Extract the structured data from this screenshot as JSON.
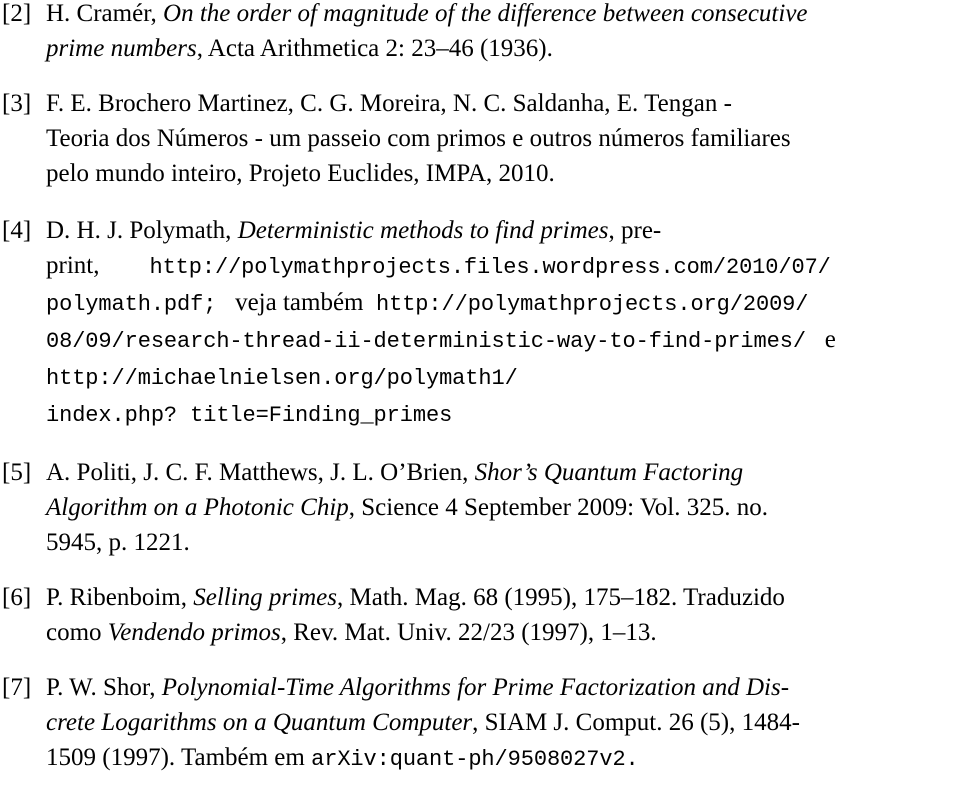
{
  "document": {
    "kind": "bibliography",
    "background_color": "#ffffff",
    "text_color": "#000000"
  },
  "references": [
    {
      "tag": "[2]",
      "number": "2",
      "authors": "H. Cramér,",
      "title": "On the order of magnitude of the difference between consecutive prime numbers",
      "source": "Acta Arithmetica 2: 23–46 (1936).",
      "lines": [
        {
          "parts": [
            {
              "text": "H. Cramér, ",
              "style": "roman"
            },
            {
              "text": "On the order of magnitude of the difference between consecutive",
              "style": "italic"
            }
          ]
        },
        {
          "parts": [
            {
              "text": "prime numbers",
              "style": "italic"
            },
            {
              "text": ", Acta Arithmetica 2: 23–46 (1936).",
              "style": "roman"
            }
          ]
        }
      ]
    },
    {
      "tag": "[3]",
      "number": "3",
      "authors": "F. E. Brochero Martinez, C. G. Moreira, N. C. Saldanha, E. Tengan",
      "title": "Teoria dos Números - um passeio com primos e outros números familiares pelo mundo inteiro",
      "source": "Projeto Euclides, IMPA, 2010.",
      "lines": [
        {
          "parts": [
            {
              "text": "F. E. Brochero Martinez, C. G. Moreira, N. C. Saldanha, E. Tengan -",
              "style": "roman"
            }
          ]
        },
        {
          "parts": [
            {
              "text": "Teoria dos Números - um passeio com primos e outros números familiares",
              "style": "roman"
            }
          ]
        },
        {
          "parts": [
            {
              "text": "pelo mundo inteiro, Projeto Euclides, IMPA, 2010.",
              "style": "roman"
            }
          ]
        }
      ]
    },
    {
      "tag": "[4]",
      "number": "4",
      "authors": "D. H. J. Polymath,",
      "title": "Deterministic methods to find primes",
      "source": "preprint",
      "urls": [
        "http://polymathprojects.files.wordpress.com/2010/07/polymath.pdf",
        "http://polymathprojects.org/2009/08/09/research-thread-ii-deterministic-way-to-find-primes/",
        "http://michaelnielsen.org/polymath1/index.php?title=Finding_primes"
      ],
      "lines": [
        {
          "parts": [
            {
              "text": "D. H. J. Polymath, ",
              "style": "roman"
            },
            {
              "text": "Deterministic methods to find primes",
              "style": "italic"
            },
            {
              "text": ", pre-",
              "style": "roman"
            }
          ]
        },
        {
          "parts": [
            {
              "text": "print,",
              "style": "roman"
            },
            {
              "text": "http://polymathprojects.files.wordpress.com/2010/07/",
              "style": "mono"
            }
          ]
        },
        {
          "parts": [
            {
              "text": "polymath.pdf;",
              "style": "mono"
            },
            {
              "text": "veja também",
              "style": "roman"
            },
            {
              "text": "http://polymathprojects.org/2009/",
              "style": "mono"
            }
          ]
        },
        {
          "parts": [
            {
              "text": "08/09/research-thread-ii-deterministic-way-to-find-primes/",
              "style": "mono"
            },
            {
              "text": "e",
              "style": "roman"
            }
          ]
        },
        {
          "parts": [
            {
              "text": "http://michaelnielsen.org/polymath1/",
              "style": "mono"
            }
          ]
        },
        {
          "parts": [
            {
              "text": "index.php? title=Finding_primes",
              "style": "mono"
            }
          ]
        }
      ],
      "line2_pre": "print,",
      "line2_url": "http://polymathprojects.files.wordpress.com/2010/07/",
      "line3_url_a": "polymath.pdf;",
      "line3_mid": "veja também",
      "line3_url_b": "http://polymathprojects.org/2009/",
      "line4_url": "08/09/research-thread-ii-deterministic-way-to-find-primes/",
      "line4_tail": "e",
      "line5_url": "http://michaelnielsen.org/polymath1/",
      "line6_url": "index.php? title=Finding_primes"
    },
    {
      "tag": "[5]",
      "number": "5",
      "authors": "A. Politi, J. C. F. Matthews, J. L. O’Brien,",
      "title": "Shor’s Quantum Factoring Algorithm on a Photonic Chip",
      "source": "Science 4 September 2009: Vol. 325. no. 5945, p. 1221.",
      "lines": [
        {
          "parts": [
            {
              "text": "A. Politi, J. C. F. Matthews, J. L. O’Brien, ",
              "style": "roman"
            },
            {
              "text": "Shor’s Quantum Factoring",
              "style": "italic"
            }
          ]
        },
        {
          "parts": [
            {
              "text": "Algorithm on a Photonic Chip",
              "style": "italic"
            },
            {
              "text": ", Science 4 September 2009: Vol. 325. no.",
              "style": "roman"
            }
          ]
        },
        {
          "parts": [
            {
              "text": "5945, p. 1221.",
              "style": "roman"
            }
          ]
        }
      ]
    },
    {
      "tag": "[6]",
      "number": "6",
      "authors": "P. Ribenboim,",
      "title": "Selling primes",
      "source": "Math. Mag. 68 (1995), 175–182. Traduzido como Vendendo primos, Rev. Mat. Univ. 22/23 (1997), 1–13.",
      "lines": [
        {
          "parts": [
            {
              "text": "P. Ribenboim, ",
              "style": "roman"
            },
            {
              "text": "Selling primes",
              "style": "italic"
            },
            {
              "text": ", Math. Mag. 68 (1995), 175–182. Traduzido",
              "style": "roman"
            }
          ]
        },
        {
          "parts": [
            {
              "text": "como ",
              "style": "roman"
            },
            {
              "text": "Vendendo primos",
              "style": "italic"
            },
            {
              "text": ", Rev. Mat. Univ. 22/23 (1997), 1–13.",
              "style": "roman"
            }
          ]
        }
      ]
    },
    {
      "tag": "[7]",
      "number": "7",
      "authors": "P. W. Shor,",
      "title": "Polynomial-Time Algorithms for Prime Factorization and Discrete Logarithms on a Quantum Computer",
      "source": "SIAM J. Comput. 26 (5), 1484-1509 (1997). Também em arXiv:quant-ph/9508027v2.",
      "arxiv": "arXiv:quant-ph/9508027v2.",
      "lines": [
        {
          "parts": [
            {
              "text": "P. W. Shor, ",
              "style": "roman"
            },
            {
              "text": "Polynomial-Time Algorithms for Prime Factorization and Dis-",
              "style": "italic"
            }
          ]
        },
        {
          "parts": [
            {
              "text": "crete Logarithms on a Quantum Computer",
              "style": "italic"
            },
            {
              "text": ", SIAM J. Comput. 26 (5), 1484-",
              "style": "roman"
            }
          ]
        },
        {
          "parts": [
            {
              "text": "1509 (1997). Também em ",
              "style": "roman"
            },
            {
              "text": "arXiv:quant-ph/9508027v2.",
              "style": "mono"
            }
          ]
        }
      ]
    }
  ],
  "text": {
    "r2_tag": "[2]",
    "r2_l1_a": "H. Cramér, ",
    "r2_l1_b": "On the order of magnitude of the difference between consecutive",
    "r2_l2_a": "prime numbers",
    "r2_l2_b": ", Acta Arithmetica 2: 23–46 (1936).",
    "r3_tag": "[3]",
    "r3_l1": "F. E. Brochero Martinez, C. G. Moreira, N. C. Saldanha, E. Tengan -",
    "r3_l2": "Teoria dos Números - um passeio com primos e outros números familiares",
    "r3_l3": "pelo mundo inteiro, Projeto Euclides, IMPA, 2010.",
    "r4_tag": "[4]",
    "r4_l1_a": "D. H. J. Polymath, ",
    "r4_l1_b": "Deterministic methods to find primes",
    "r4_l1_c": ", pre-",
    "r4_l2_a": "print,",
    "r4_l2_b": "http://polymathprojects.files.wordpress.com/2010/07/",
    "r4_l3_a": "polymath.pdf;",
    "r4_l3_b": "veja também",
    "r4_l3_c": "http://polymathprojects.org/2009/",
    "r4_l4_a": "08/09/research-thread-ii-deterministic-way-to-find-primes/",
    "r4_l4_b": "e",
    "r4_l5": "http://michaelnielsen.org/polymath1/",
    "r4_l6": "index.php? title=Finding_primes",
    "r5_tag": "[5]",
    "r5_l1_a": "A. Politi, J. C. F. Matthews, J. L. O’Brien, ",
    "r5_l1_b": "Shor’s Quantum Factoring",
    "r5_l2_a": "Algorithm on a Photonic Chip",
    "r5_l2_b": ", Science 4 September 2009: Vol. 325. no.",
    "r5_l3": "5945, p. 1221.",
    "r6_tag": "[6]",
    "r6_l1_a": "P. Ribenboim, ",
    "r6_l1_b": "Selling primes",
    "r6_l1_c": ", Math. Mag. 68 (1995), 175–182. Traduzido",
    "r6_l2_a": "como ",
    "r6_l2_b": "Vendendo primos",
    "r6_l2_c": ", Rev. Mat. Univ. 22/23 (1997), 1–13.",
    "r7_tag": "[7]",
    "r7_l1_a": "P. W. Shor, ",
    "r7_l1_b": "Polynomial-Time Algorithms for Prime Factorization and Dis-",
    "r7_l2_a": "crete Logarithms on a Quantum Computer",
    "r7_l2_b": ", SIAM J. Comput. 26 (5), 1484-",
    "r7_l3_a": "1509 (1997). Também em ",
    "r7_l3_b": "arXiv:quant-ph/9508027v2."
  }
}
